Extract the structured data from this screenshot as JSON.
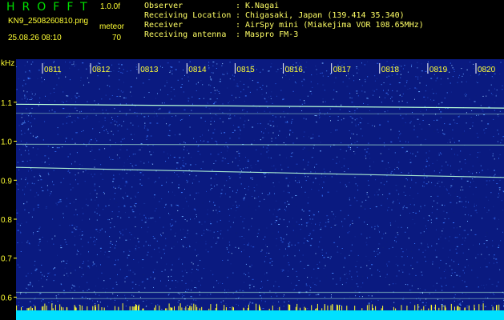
{
  "header": {
    "brand": "HROFFT",
    "version": "1.0.0f",
    "filename": "KN9_2508260810.png",
    "meteor_label": "meteor",
    "timestamp": "25.08.26 08:10",
    "meteor_count": "70"
  },
  "info": [
    {
      "key": "Observer",
      "value": "K.Nagai"
    },
    {
      "key": "Receiving Location",
      "value": "Chigasaki, Japan (139.414 35.340)"
    },
    {
      "key": "Receiver",
      "value": "AirSpy mini (Miakejima VOR 108.65MHz)"
    },
    {
      "key": "Receiving antenna",
      "value": "Maspro FM-3"
    }
  ],
  "spectrogram": {
    "y_unit": "kHz",
    "freq_range": [
      0.57,
      1.19
    ],
    "y_ticks": [
      {
        "value": 1.1,
        "label": "1.1"
      },
      {
        "value": 1.0,
        "label": "1.0"
      },
      {
        "value": 0.9,
        "label": "0.9"
      },
      {
        "value": 0.8,
        "label": "0.8"
      },
      {
        "value": 0.7,
        "label": "0.7"
      },
      {
        "value": 0.6,
        "label": "0.6"
      }
    ],
    "time_labels": [
      "0811",
      "0812",
      "0813",
      "0814",
      "0815",
      "0816",
      "0817",
      "0818",
      "0819",
      "0820"
    ],
    "signal_lines": [
      {
        "start_khz": 1.095,
        "end_khz": 1.085,
        "strength": 1.0
      },
      {
        "start_khz": 0.933,
        "end_khz": 0.907,
        "strength": 0.9
      },
      {
        "start_khz": 0.992,
        "end_khz": 0.99,
        "strength": 0.55
      },
      {
        "start_khz": 1.072,
        "end_khz": 1.07,
        "strength": 0.35
      },
      {
        "start_khz": 0.612,
        "end_khz": 0.612,
        "strength": 0.45
      },
      {
        "start_khz": 0.596,
        "end_khz": 0.596,
        "strength": 0.4
      }
    ],
    "colors": {
      "background": "#0a1a80",
      "noise_dark": "#08105a",
      "noise_light": "#3a78ff",
      "signal": "#b8ffd8",
      "axis_text": "#ffff33",
      "floor": "#00e0ff"
    }
  }
}
